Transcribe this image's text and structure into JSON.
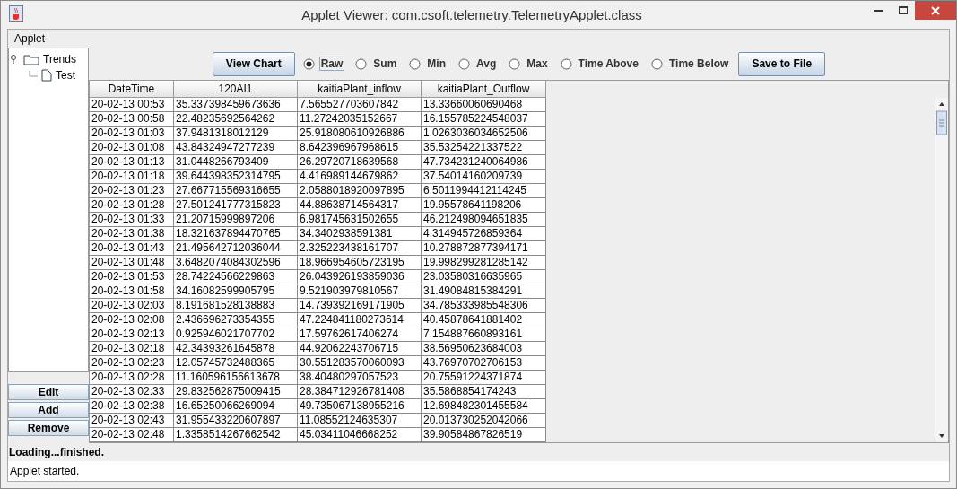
{
  "window": {
    "title": "Applet Viewer: com.csoft.telemetry.TelemetryApplet.class"
  },
  "menu": [
    "Applet"
  ],
  "tree": [
    {
      "label": "Trends",
      "kind": "folder",
      "expanded": true,
      "children": [
        {
          "label": "Test",
          "kind": "file"
        }
      ]
    }
  ],
  "side_buttons": [
    "Edit",
    "Add",
    "Remove"
  ],
  "toolbar": {
    "chart_button": "View Chart",
    "save_button": "Save to File",
    "modes": [
      {
        "label": "Raw",
        "selected": true
      },
      {
        "label": "Sum",
        "selected": false
      },
      {
        "label": "Min",
        "selected": false
      },
      {
        "label": "Avg",
        "selected": false
      },
      {
        "label": "Max",
        "selected": false
      },
      {
        "label": "Time Above",
        "selected": false
      },
      {
        "label": "Time Below",
        "selected": false
      }
    ]
  },
  "table": {
    "columns": [
      "DateTime",
      "120AI1",
      "kaitiaPlant_inflow",
      "kaitiaPlant_Outflow"
    ],
    "rows": [
      [
        "20-02-13 00:53",
        "35.337398459673636",
        "7.565527703607842",
        "13.33660060690468"
      ],
      [
        "20-02-13 00:58",
        "22.48235692564262",
        "11.27242035152667",
        "16.155785224548037"
      ],
      [
        "20-02-13 01:03",
        "37.9481318012129",
        "25.918080610926886",
        "1.0263036034652506"
      ],
      [
        "20-02-13 01:08",
        "43.84324947277239",
        "8.642396967968615",
        "35.53254221337522"
      ],
      [
        "20-02-13 01:13",
        "31.0448266793409",
        "26.29720718639568",
        "47.734231240064986"
      ],
      [
        "20-02-13 01:18",
        "39.644398352314795",
        "4.416989144679862",
        "37.54014160209739"
      ],
      [
        "20-02-13 01:23",
        "27.667715569316655",
        "2.0588018920097895",
        "6.5011994412114245"
      ],
      [
        "20-02-13 01:28",
        "27.501241777315823",
        "44.88638714564317",
        "19.95578641198206"
      ],
      [
        "20-02-13 01:33",
        "21.20715999897206",
        "6.981745631502655",
        "46.212498094651835"
      ],
      [
        "20-02-13 01:38",
        "18.321637894470765",
        "34.3402938591381",
        "4.314945726859364"
      ],
      [
        "20-02-13 01:43",
        "21.495642712036044",
        "2.325223438161707",
        "10.278872877394171"
      ],
      [
        "20-02-13 01:48",
        "3.6482074084302596",
        "18.966954605723195",
        "19.998299281285142"
      ],
      [
        "20-02-13 01:53",
        "28.74224566229863",
        "26.043926193859036",
        "23.03580316635965"
      ],
      [
        "20-02-13 01:58",
        "34.16082599905795",
        "9.521903979810567",
        "31.49084815384291"
      ],
      [
        "20-02-13 02:03",
        "8.191681528138883",
        "14.739392169171905",
        "34.785333985548306"
      ],
      [
        "20-02-13 02:08",
        "2.436696273354355",
        "47.224841180273614",
        "40.45878641881402"
      ],
      [
        "20-02-13 02:13",
        "0.925946021707702",
        "17.59762617406274",
        "7.154887660893161"
      ],
      [
        "20-02-13 02:18",
        "42.34393261645878",
        "44.92062243706715",
        "38.56950623684003"
      ],
      [
        "20-02-13 02:23",
        "12.05745732488365",
        "30.551283570060093",
        "43.76970702706153"
      ],
      [
        "20-02-13 02:28",
        "11.160596156613678",
        "38.40480297057523",
        "20.75591224371874"
      ],
      [
        "20-02-13 02:33",
        "29.832562875009415",
        "28.384712926781408",
        "35.5868854174243"
      ],
      [
        "20-02-13 02:38",
        "16.65250066269094",
        "49.735067138955216",
        "12.698482301455584"
      ],
      [
        "20-02-13 02:43",
        "31.955433220607897",
        "11.08552124635307",
        "20.013730252042066"
      ],
      [
        "20-02-13 02:48",
        "1.3358514267662542",
        "45.03411046668252",
        "39.90584867826519"
      ]
    ]
  },
  "status": {
    "loading": "Loading...finished.",
    "applet": "Applet started."
  }
}
